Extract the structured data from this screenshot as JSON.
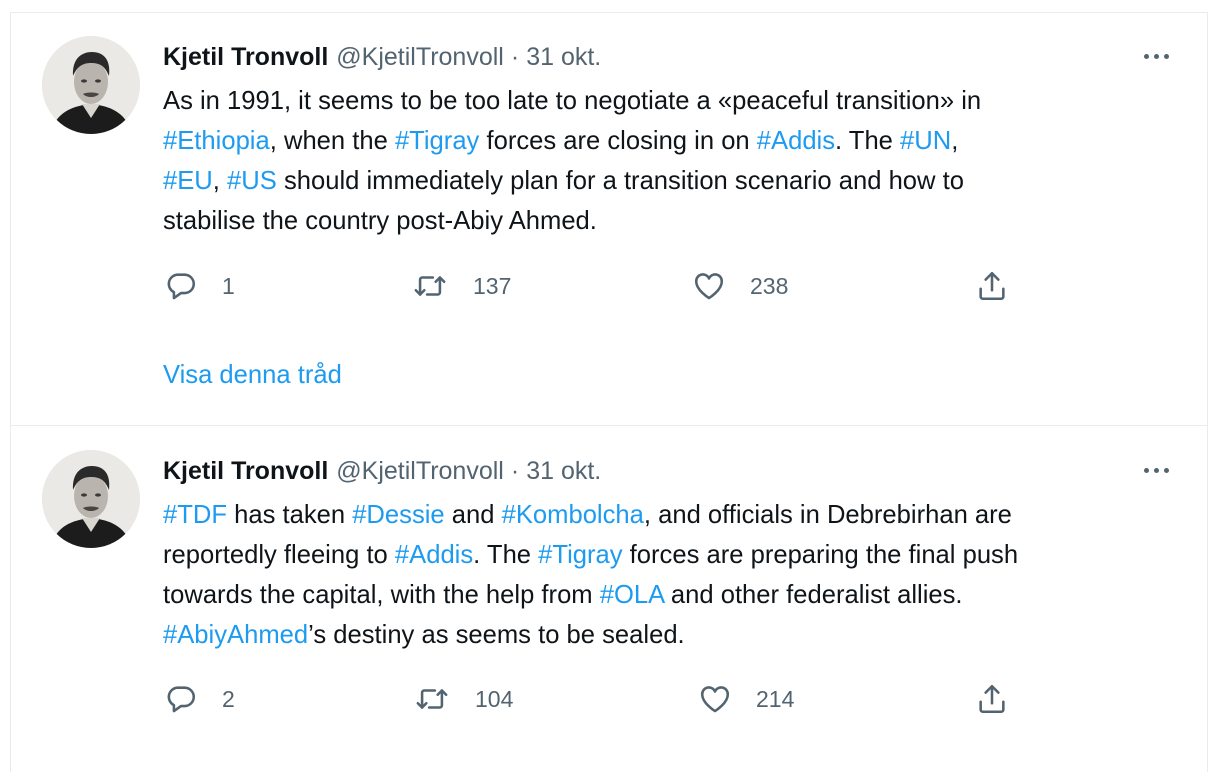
{
  "tweets": [
    {
      "name": "Kjetil Tronvoll",
      "handle": "@KjetilTronvoll",
      "separator": "·",
      "date": "31 okt.",
      "lines": [
        [
          {
            "t": "As in 1991, it seems to be too late to negotiate a «peaceful transition» in",
            "tag": false
          }
        ],
        [
          {
            "t": "#Ethiopia",
            "tag": true
          },
          {
            "t": ", when the ",
            "tag": false
          },
          {
            "t": "#Tigray",
            "tag": true
          },
          {
            "t": " forces are closing in on ",
            "tag": false
          },
          {
            "t": "#Addis",
            "tag": true
          },
          {
            "t": ". The ",
            "tag": false
          },
          {
            "t": "#UN",
            "tag": true
          },
          {
            "t": ",",
            "tag": false
          }
        ],
        [
          {
            "t": "#EU",
            "tag": true
          },
          {
            "t": ", ",
            "tag": false
          },
          {
            "t": "#US",
            "tag": true
          },
          {
            "t": " should immediately plan for a transition scenario and how to",
            "tag": false
          }
        ],
        [
          {
            "t": "stabilise the country post-Abiy Ahmed.",
            "tag": false
          }
        ]
      ],
      "replies": "1",
      "retweets": "137",
      "likes": "238",
      "show_thread": "Visa denna tråd"
    },
    {
      "name": "Kjetil Tronvoll",
      "handle": "@KjetilTronvoll",
      "separator": "·",
      "date": "31 okt.",
      "lines": [
        [
          {
            "t": "#TDF",
            "tag": true
          },
          {
            "t": " has taken ",
            "tag": false
          },
          {
            "t": "#Dessie",
            "tag": true
          },
          {
            "t": " and ",
            "tag": false
          },
          {
            "t": "#Kombolcha",
            "tag": true
          },
          {
            "t": ", and officials in Debrebirhan are",
            "tag": false
          }
        ],
        [
          {
            "t": "reportedly fleeing to ",
            "tag": false
          },
          {
            "t": "#Addis",
            "tag": true
          },
          {
            "t": ". The ",
            "tag": false
          },
          {
            "t": "#Tigray",
            "tag": true
          },
          {
            "t": " forces are preparing the final push",
            "tag": false
          }
        ],
        [
          {
            "t": "towards the capital, with the help from ",
            "tag": false
          },
          {
            "t": "#OLA",
            "tag": true
          },
          {
            "t": " and other federalist allies.",
            "tag": false
          }
        ],
        [
          {
            "t": "#AbiyAhmed",
            "tag": true
          },
          {
            "t": "’s destiny as seems to be sealed.",
            "tag": false
          }
        ]
      ],
      "replies": "2",
      "retweets": "104",
      "likes": "214"
    }
  ],
  "icons": {
    "reply": "reply-icon",
    "retweet": "retweet-icon",
    "like": "heart-icon",
    "share": "share-icon",
    "more": "more-icon"
  },
  "colors": {
    "link": "#1d9bf0",
    "secondary": "#536471",
    "text": "#0f1419"
  }
}
